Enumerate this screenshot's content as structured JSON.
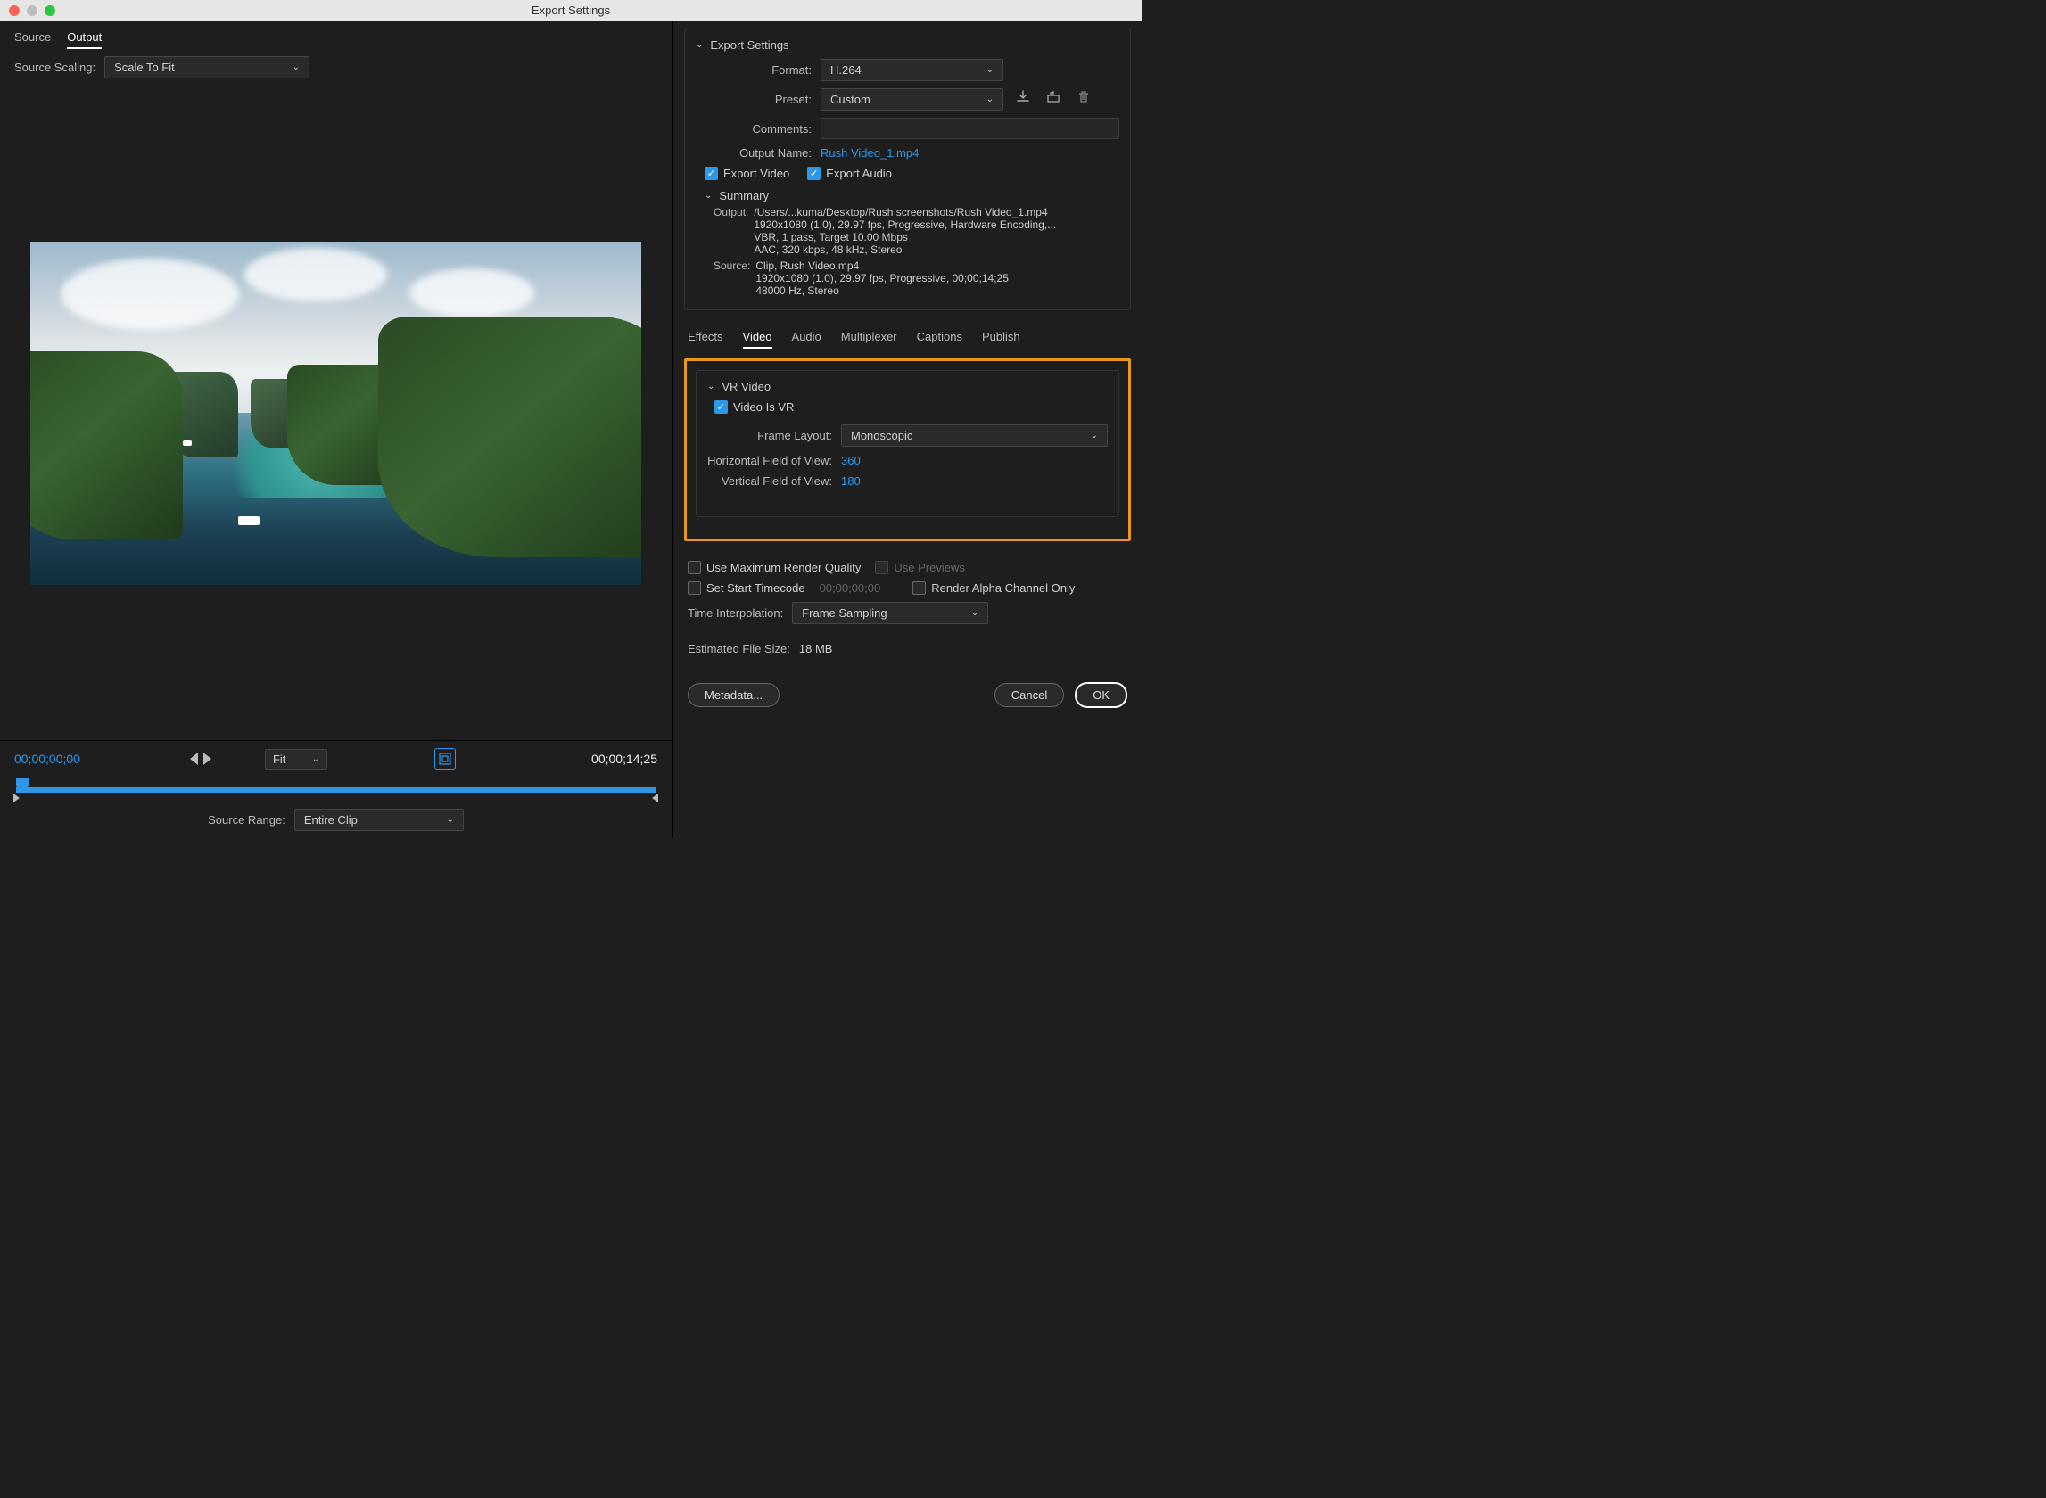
{
  "title": "Export Settings",
  "left": {
    "tabs": {
      "source": "Source",
      "output": "Output"
    },
    "scale_label": "Source Scaling:",
    "scale_value": "Scale To Fit",
    "time_start": "00;00;00;00",
    "time_end": "00;00;14;25",
    "fit_label": "Fit",
    "source_range_label": "Source Range:",
    "source_range_value": "Entire Clip"
  },
  "export": {
    "header": "Export Settings",
    "format_label": "Format:",
    "format_value": "H.264",
    "preset_label": "Preset:",
    "preset_value": "Custom",
    "comments_label": "Comments:",
    "comments_value": "",
    "output_name_label": "Output Name:",
    "output_name_value": "Rush Video_1.mp4",
    "export_video_label": "Export Video",
    "export_audio_label": "Export Audio",
    "summary_header": "Summary",
    "summary": {
      "output_key": "Output:",
      "output_lines": [
        "/Users/...kuma/Desktop/Rush screenshots/Rush Video_1.mp4",
        "1920x1080 (1.0), 29.97 fps, Progressive, Hardware Encoding,...",
        "VBR, 1 pass, Target 10.00 Mbps",
        "AAC, 320 kbps, 48 kHz, Stereo"
      ],
      "source_key": "Source:",
      "source_lines": [
        "Clip, Rush Video.mp4",
        "1920x1080 (1.0), 29.97 fps, Progressive, 00;00;14;25",
        "48000 Hz, Stereo"
      ]
    }
  },
  "subtabs": {
    "effects": "Effects",
    "video": "Video",
    "audio": "Audio",
    "multiplexer": "Multiplexer",
    "captions": "Captions",
    "publish": "Publish"
  },
  "vr": {
    "header": "VR Video",
    "is_vr_label": "Video Is VR",
    "frame_layout_label": "Frame Layout:",
    "frame_layout_value": "Monoscopic",
    "hfov_label": "Horizontal Field of View:",
    "hfov_value": "360",
    "vfov_label": "Vertical Field of View:",
    "vfov_value": "180"
  },
  "bottom": {
    "max_render_label": "Use Maximum Render Quality",
    "use_previews_label": "Use Previews",
    "start_timecode_label": "Set Start Timecode",
    "start_timecode_value": "00;00;00;00",
    "render_alpha_label": "Render Alpha Channel Only",
    "time_interp_label": "Time Interpolation:",
    "time_interp_value": "Frame Sampling",
    "est_size_label": "Estimated File Size:",
    "est_size_value": "18 MB"
  },
  "buttons": {
    "metadata": "Metadata...",
    "cancel": "Cancel",
    "ok": "OK"
  }
}
